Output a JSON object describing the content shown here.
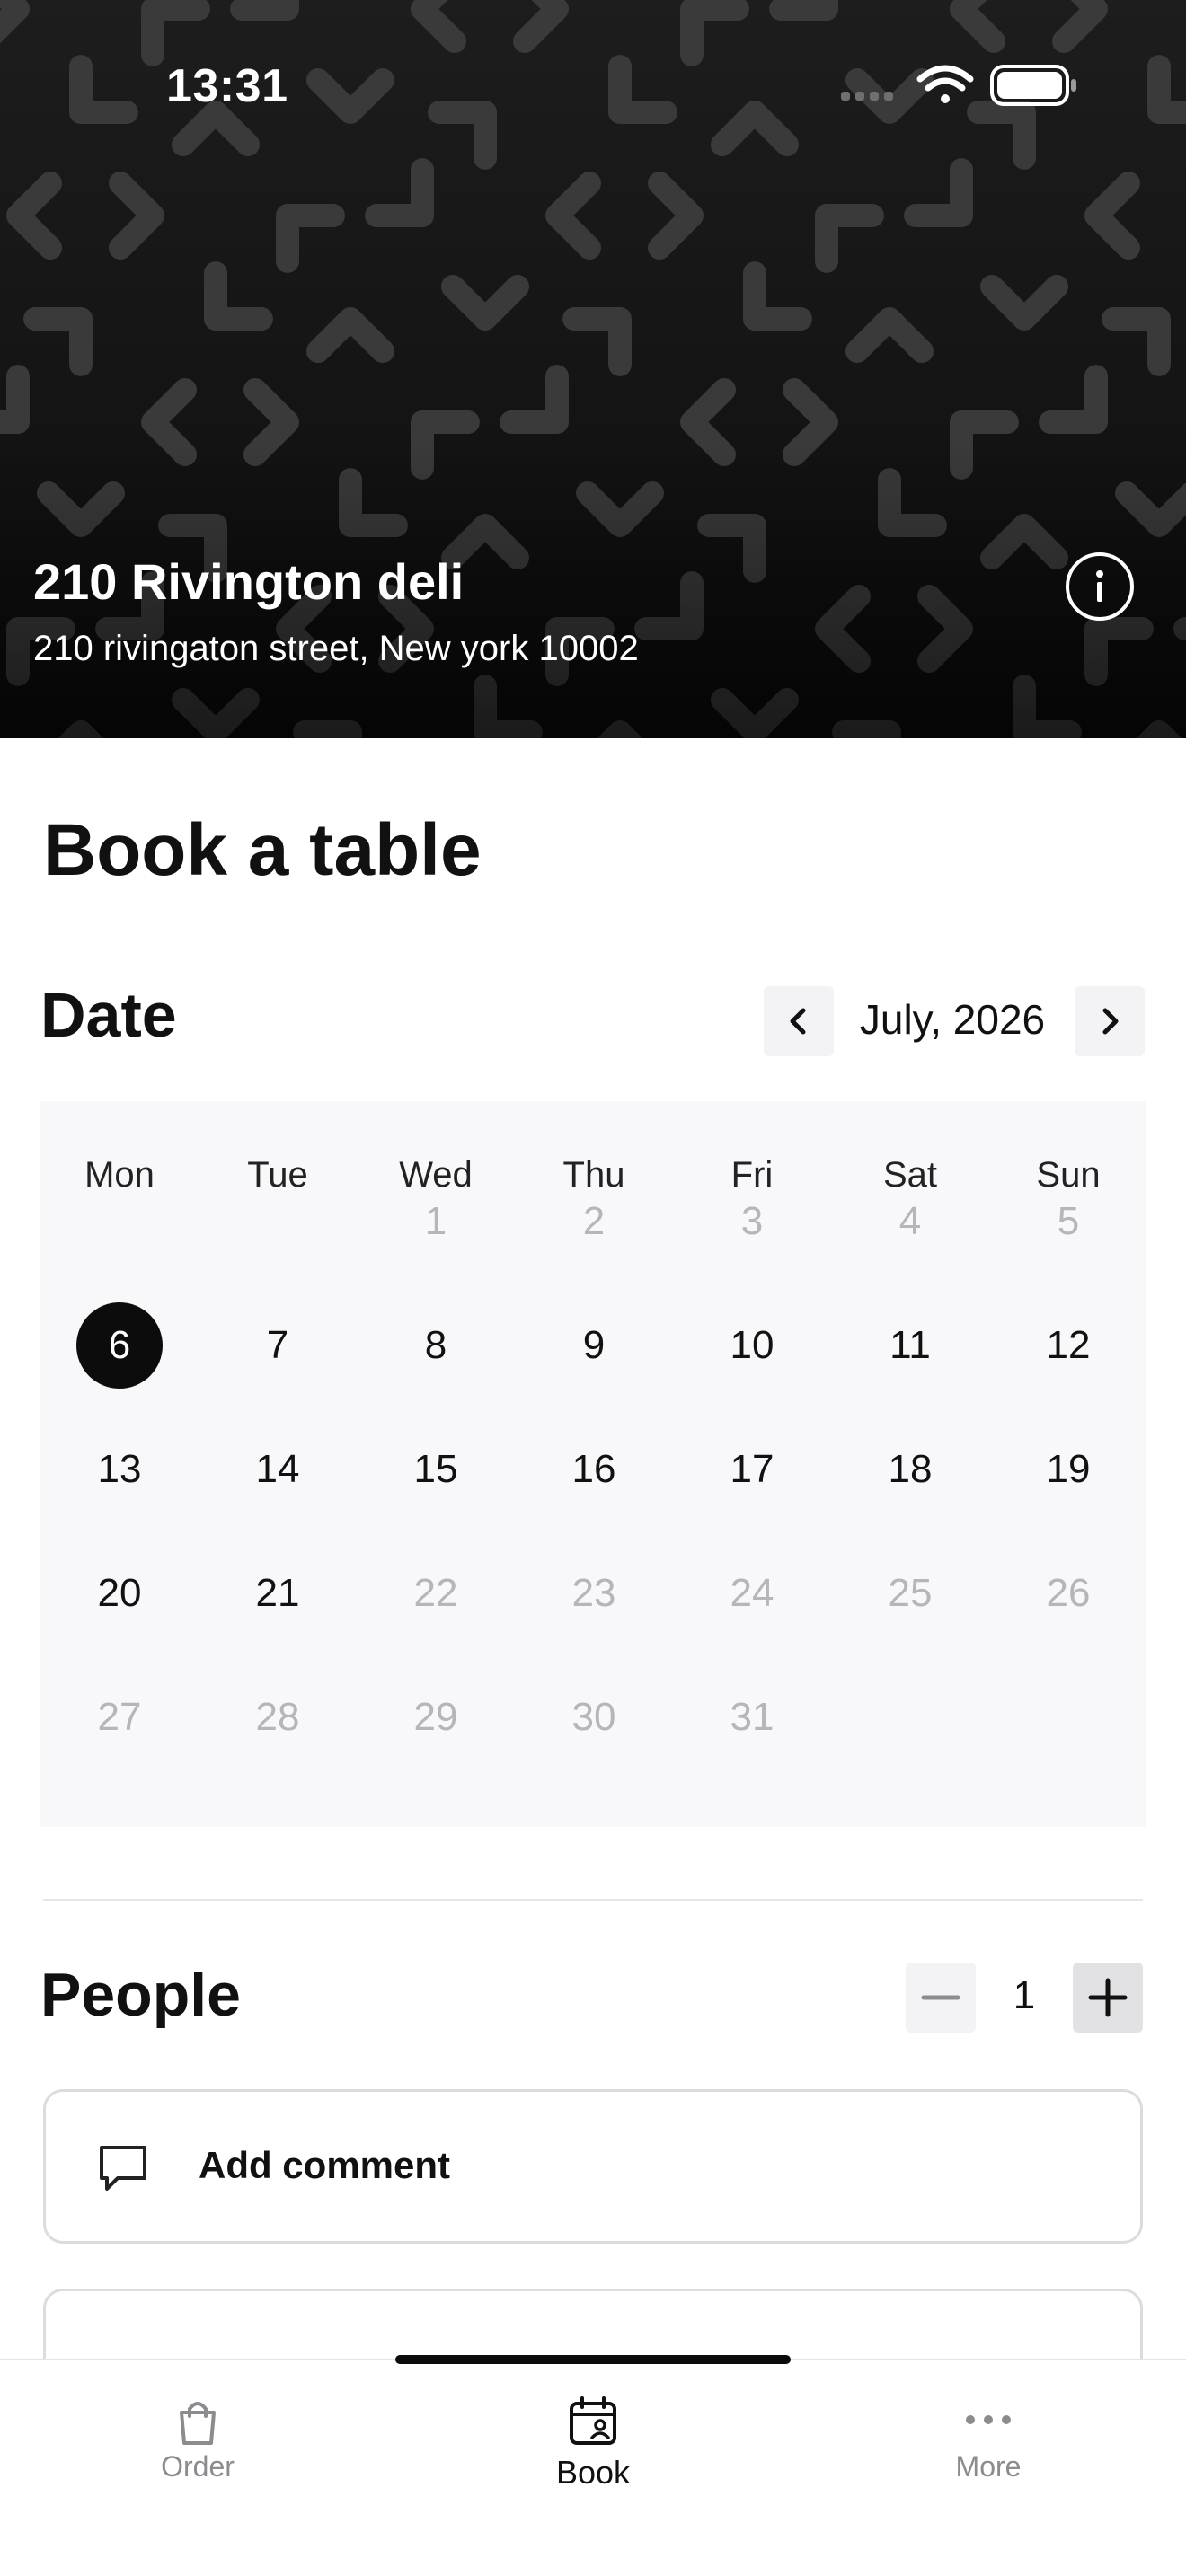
{
  "status_bar": {
    "time": "13:31"
  },
  "venue": {
    "name": "210 Rivington deli",
    "address": "210 rivingaton street, New york 10002"
  },
  "page": {
    "title": "Book a table"
  },
  "date_section": {
    "title": "Date",
    "month_label": "July, 2026",
    "weekdays": [
      "Mon",
      "Tue",
      "Wed",
      "Thu",
      "Fri",
      "Sat",
      "Sun"
    ],
    "selected_day": "6",
    "weeks": [
      [
        "",
        "",
        "1",
        "2",
        "3",
        "4",
        "5"
      ],
      [
        "6",
        "7",
        "8",
        "9",
        "10",
        "11",
        "12"
      ],
      [
        "13",
        "14",
        "15",
        "16",
        "17",
        "18",
        "19"
      ],
      [
        "20",
        "21",
        "22",
        "23",
        "24",
        "25",
        "26"
      ],
      [
        "27",
        "28",
        "29",
        "30",
        "31",
        "",
        ""
      ]
    ],
    "available_days": [
      "6",
      "7",
      "8",
      "9",
      "10",
      "11",
      "12",
      "13",
      "14",
      "15",
      "16",
      "17",
      "18",
      "19",
      "20",
      "21"
    ]
  },
  "people_section": {
    "title": "People",
    "count": "1"
  },
  "comment": {
    "label": "Add comment"
  },
  "tabbar": {
    "tabs": [
      {
        "label": "Order",
        "icon": "bag-icon",
        "active": false
      },
      {
        "label": "Book",
        "icon": "calendar-person-icon",
        "active": true
      },
      {
        "label": "More",
        "icon": "more-dots-icon",
        "active": false
      }
    ]
  },
  "colors": {
    "accent": "#0c0c0c",
    "muted_day": "#b5b5ba",
    "calendar_bg": "#f8f8fa",
    "inactive_tab": "#8b8b90"
  }
}
